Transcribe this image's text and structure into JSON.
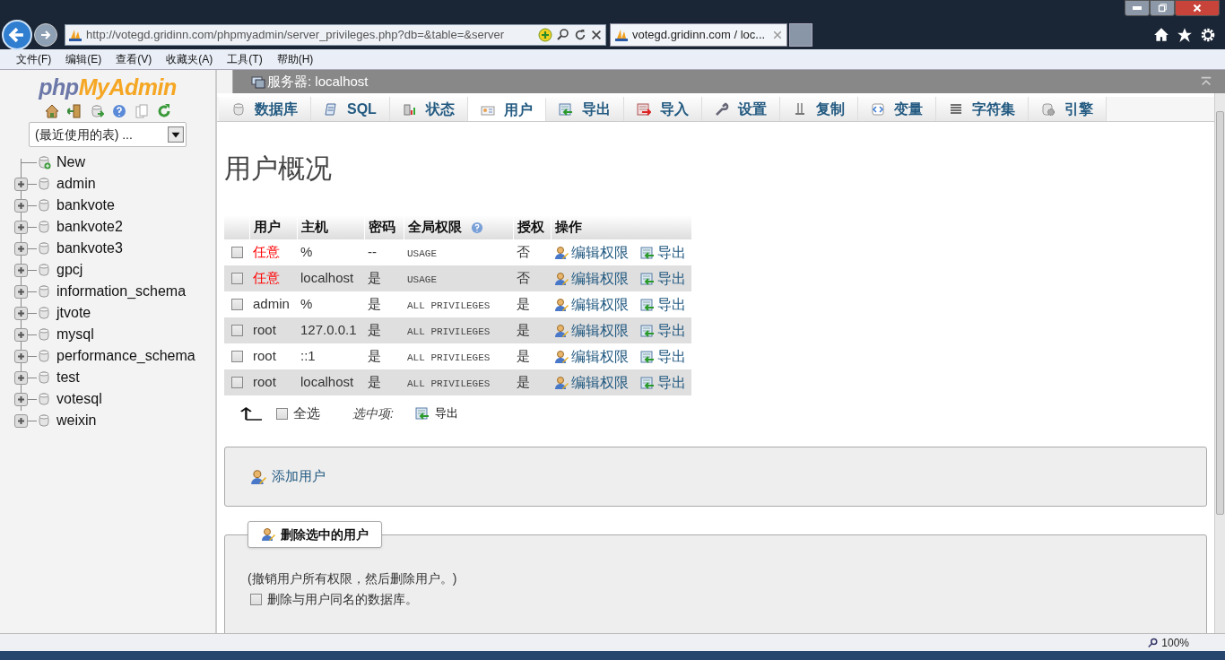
{
  "browser": {
    "address": "http://votegd.gridinn.com/phpmyadmin/server_privileges.php?db=&table=&server",
    "tabs": [
      {
        "title": "votegd.gridinn.com / loc...",
        "selected": true
      }
    ]
  },
  "menu": [
    "文件(F)",
    "编辑(E)",
    "查看(V)",
    "收藏夹(A)",
    "工具(T)",
    "帮助(H)"
  ],
  "sidebar": {
    "logo": [
      "php",
      "MyAdmin"
    ],
    "recent_tables": "(最近使用的表) ...",
    "tree": [
      {
        "name": "New",
        "kind": "new"
      },
      {
        "name": "admin",
        "kind": "database",
        "expanded": false
      },
      {
        "name": "bankvote",
        "kind": "database",
        "expanded": false
      },
      {
        "name": "bankvote2",
        "kind": "database",
        "expanded": false
      },
      {
        "name": "bankvote3",
        "kind": "database",
        "expanded": false
      },
      {
        "name": "gpcj",
        "kind": "database",
        "expanded": false
      },
      {
        "name": "information_schema",
        "kind": "database",
        "expanded": false
      },
      {
        "name": "jtvote",
        "kind": "database",
        "expanded": false
      },
      {
        "name": "mysql",
        "kind": "database",
        "expanded": false
      },
      {
        "name": "performance_schema",
        "kind": "database",
        "expanded": false
      },
      {
        "name": "test",
        "kind": "database",
        "expanded": false
      },
      {
        "name": "votesql",
        "kind": "database",
        "expanded": false
      },
      {
        "name": "weixin",
        "kind": "database",
        "expanded": false
      }
    ]
  },
  "breadcrumb": "服务器: localhost",
  "tabs": [
    {
      "label": "数据库",
      "selected": false
    },
    {
      "label": "SQL",
      "selected": false
    },
    {
      "label": "状态",
      "selected": false
    },
    {
      "label": "用户",
      "selected": true
    },
    {
      "label": "导出",
      "selected": false
    },
    {
      "label": "导入",
      "selected": false
    },
    {
      "label": "设置",
      "selected": false
    },
    {
      "label": "复制",
      "selected": false
    },
    {
      "label": "变量",
      "selected": false
    },
    {
      "label": "字符集",
      "selected": false
    },
    {
      "label": "引擎",
      "selected": false
    }
  ],
  "heading": "用户概况",
  "table": {
    "columns": [
      "用户",
      "主机",
      "密码",
      "全局权限",
      "授权",
      "操作"
    ],
    "rows": [
      {
        "checked": false,
        "user": "任意",
        "kind": "anonymous",
        "host": "%",
        "password": "--",
        "privileges": "USAGE",
        "grant": "否",
        "edit": "编辑权限",
        "export": "导出"
      },
      {
        "checked": false,
        "user": "任意",
        "kind": "anonymous",
        "host": "localhost",
        "password": "是",
        "privileges": "USAGE",
        "grant": "否",
        "edit": "编辑权限",
        "export": "导出"
      },
      {
        "checked": false,
        "user": "admin",
        "kind": "named",
        "host": "%",
        "password": "是",
        "privileges": "ALL PRIVILEGES",
        "grant": "是",
        "edit": "编辑权限",
        "export": "导出"
      },
      {
        "checked": false,
        "user": "root",
        "kind": "named",
        "host": "127.0.0.1",
        "password": "是",
        "privileges": "ALL PRIVILEGES",
        "grant": "是",
        "edit": "编辑权限",
        "export": "导出"
      },
      {
        "checked": false,
        "user": "root",
        "kind": "named",
        "host": "::1",
        "password": "是",
        "privileges": "ALL PRIVILEGES",
        "grant": "是",
        "edit": "编辑权限",
        "export": "导出"
      },
      {
        "checked": false,
        "user": "root",
        "kind": "named",
        "host": "localhost",
        "password": "是",
        "privileges": "ALL PRIVILEGES",
        "grant": "是",
        "edit": "编辑权限",
        "export": "导出"
      }
    ]
  },
  "bulk": {
    "select_all": "全选",
    "select_all_checked": false,
    "with_selected": "选中项:",
    "export": "导出"
  },
  "add_user": "添加用户",
  "delete_section": {
    "legend": "删除选中的用户",
    "note": "(撤销用户所有权限，然后删除用户。)",
    "drop_db_label": "删除与用户同名的数据库。",
    "drop_db_checked": false
  },
  "status_bar": {
    "zoom": "100%"
  }
}
